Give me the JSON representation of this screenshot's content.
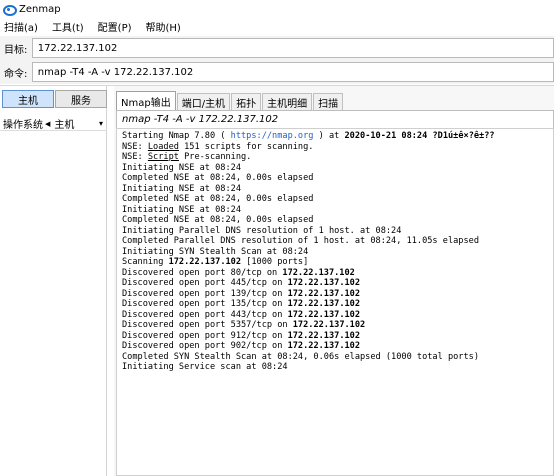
{
  "window": {
    "title": "Zenmap",
    "icon": "zenmap-eye-icon"
  },
  "menu": [
    {
      "label": "扫描(a)"
    },
    {
      "label": "工具(t)"
    },
    {
      "label": "配置(P)"
    },
    {
      "label": "帮助(H)"
    }
  ],
  "target": {
    "label": "目标:",
    "value": "172.22.137.102"
  },
  "command": {
    "label": "命令:",
    "value": "nmap -T4 -A -v 172.22.137.102"
  },
  "left_panel": {
    "hosts_button": "主机",
    "services_button": "服务",
    "col_os": "操作系统",
    "col_host": "主机",
    "sort_icon": "sort-arrow-icon",
    "dropdown_icon": "dropdown-chevron-icon"
  },
  "tabs": [
    {
      "label": "Nmap输出",
      "active": true
    },
    {
      "label": "端口/主机",
      "active": false
    },
    {
      "label": "拓扑",
      "active": false
    },
    {
      "label": "主机明细",
      "active": false
    },
    {
      "label": "扫描",
      "active": false
    }
  ],
  "output_selector": "nmap -T4 -A -v 172.22.137.102",
  "output": {
    "l1_a": "Starting Nmap 7.80 ( ",
    "l1_link": "https://nmap.org",
    "l1_b": " ) at ",
    "l1_date": "2020-10-21 08:24",
    "l1_tz": " ?D1ú±ê×?ê±??",
    "l2_a": "NSE: ",
    "l2_u": "Loaded",
    "l2_b": " 151 scripts for scanning.",
    "l3_a": "NSE: ",
    "l3_u": "Script",
    "l3_b": " Pre-scanning.",
    "l4": "Initiating NSE at 08:24",
    "l5": "Completed NSE at 08:24, 0.00s elapsed",
    "l6": "Initiating NSE at 08:24",
    "l7": "Completed NSE at 08:24, 0.00s elapsed",
    "l8": "Initiating NSE at 08:24",
    "l9": "Completed NSE at 08:24, 0.00s elapsed",
    "l10": "Initiating Parallel DNS resolution of 1 host. at 08:24",
    "l11": "Completed Parallel DNS resolution of 1 host. at 08:24, 11.05s elapsed",
    "l12": "Initiating SYN Stealth Scan at 08:24",
    "l13_a": "Scanning ",
    "l13_ip": "172.22.137.102",
    "l13_b": " [1000 ports]",
    "ports": [
      {
        "text": "Discovered open port 80/tcp on ",
        "ip": "172.22.137.102"
      },
      {
        "text": "Discovered open port 445/tcp on ",
        "ip": "172.22.137.102"
      },
      {
        "text": "Discovered open port 139/tcp on ",
        "ip": "172.22.137.102"
      },
      {
        "text": "Discovered open port 135/tcp on ",
        "ip": "172.22.137.102"
      },
      {
        "text": "Discovered open port 443/tcp on ",
        "ip": "172.22.137.102"
      },
      {
        "text": "Discovered open port 5357/tcp on ",
        "ip": "172.22.137.102"
      },
      {
        "text": "Discovered open port 912/tcp on ",
        "ip": "172.22.137.102"
      },
      {
        "text": "Discovered open port 902/tcp on ",
        "ip": "172.22.137.102"
      }
    ],
    "l22": "Completed SYN Stealth Scan at 08:24, 0.06s elapsed (1000 total ports)",
    "l23": "Initiating Service scan at 08:24"
  }
}
